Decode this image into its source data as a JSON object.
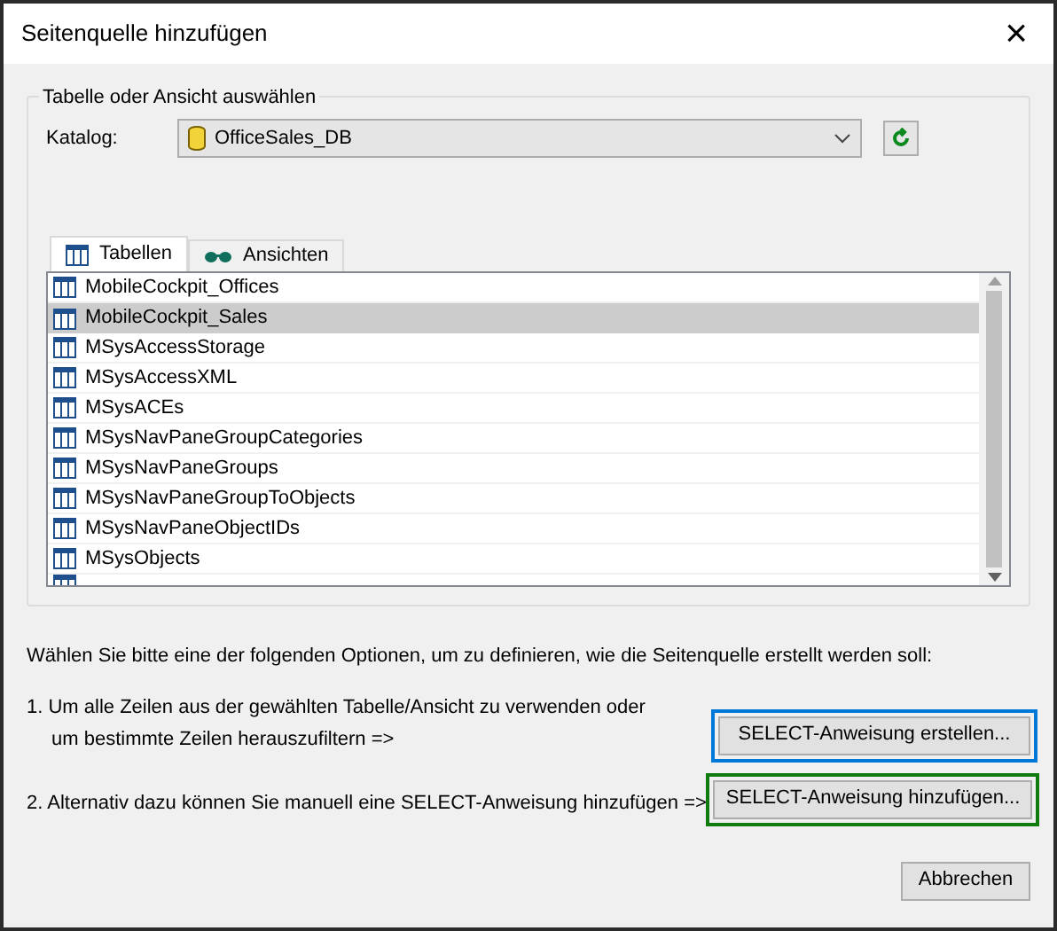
{
  "window": {
    "title": "Seitenquelle hinzufügen",
    "close": "×"
  },
  "group": {
    "legend": "Tabelle oder Ansicht auswählen",
    "catalog_label": "Katalog:",
    "catalog_value": "OfficeSales_DB"
  },
  "tabs": [
    {
      "label": "Tabellen",
      "selected": true,
      "kind": "table"
    },
    {
      "label": "Ansichten",
      "selected": false,
      "kind": "view"
    }
  ],
  "tables": [
    {
      "name": "MobileCockpit_Offices",
      "selected": false
    },
    {
      "name": "MobileCockpit_Sales",
      "selected": true
    },
    {
      "name": "MSysAccessStorage",
      "selected": false
    },
    {
      "name": "MSysAccessXML",
      "selected": false
    },
    {
      "name": "MSysACEs",
      "selected": false
    },
    {
      "name": "MSysNavPaneGroupCategories",
      "selected": false
    },
    {
      "name": "MSysNavPaneGroups",
      "selected": false
    },
    {
      "name": "MSysNavPaneGroupToObjects",
      "selected": false
    },
    {
      "name": "MSysNavPaneObjectIDs",
      "selected": false
    },
    {
      "name": "MSysObjects",
      "selected": false
    }
  ],
  "instruction": "Wählen Sie bitte eine der folgenden Optionen, um zu definieren, wie die Seitenquelle erstellt werden soll:",
  "options": [
    {
      "lines": [
        "1. Um alle Zeilen aus der gewählten Tabelle/Ansicht zu verwenden oder",
        "um bestimmte Zeilen herauszufiltern =>"
      ],
      "button": "SELECT-Anweisung erstellen...",
      "color": "#0078d7"
    },
    {
      "lines": [
        "2. Alternativ dazu können Sie manuell eine SELECT-Anweisung hinzufügen =>"
      ],
      "button": "SELECT-Anweisung hinzufügen...",
      "color": "#107c10"
    }
  ],
  "cancel": "Abbrechen"
}
